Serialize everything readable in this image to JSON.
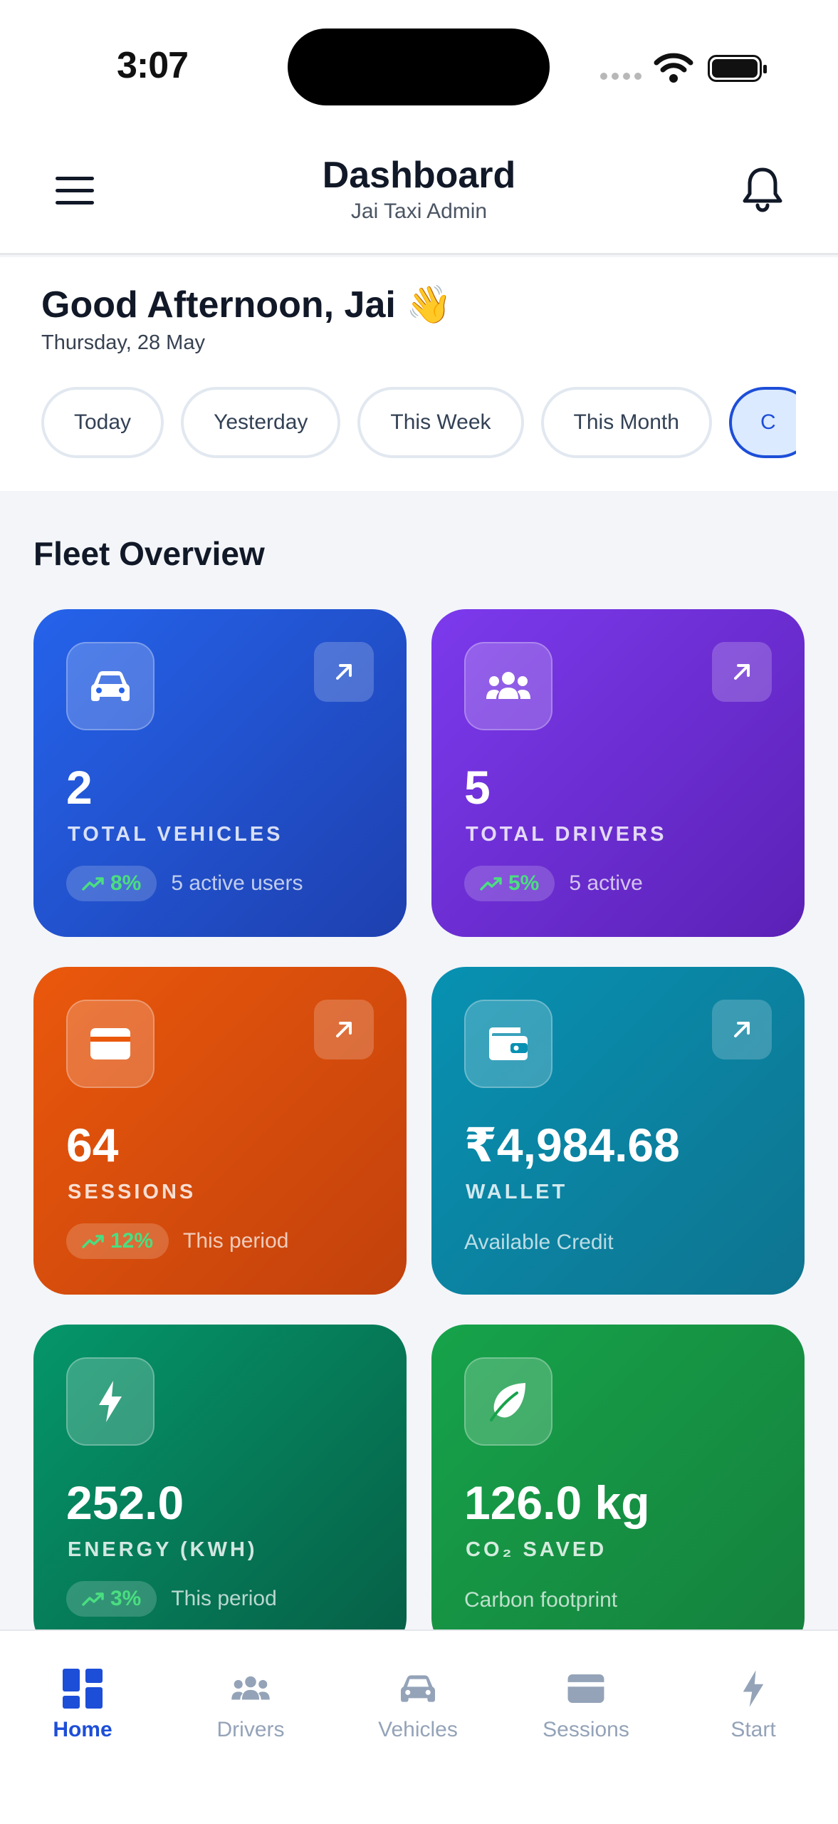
{
  "status_bar": {
    "time": "3:07"
  },
  "header": {
    "title": "Dashboard",
    "subtitle": "Jai Taxi Admin",
    "menu_icon": "hamburger-icon",
    "bell_icon": "bell-icon"
  },
  "greeting": {
    "title": "Good Afternoon, Jai 👋",
    "date": "Thursday, 28 May"
  },
  "filters": [
    "Today",
    "Yesterday",
    "This Week",
    "This Month",
    "C"
  ],
  "overview": {
    "title": "Fleet Overview",
    "cards": [
      {
        "value": "2",
        "label": "TOTAL VEHICLES",
        "trend": "8%",
        "note": "5 active users",
        "icon": "car-icon"
      },
      {
        "value": "5",
        "label": "TOTAL DRIVERS",
        "trend": "5%",
        "note": "5 active",
        "icon": "users-icon"
      },
      {
        "value": "64",
        "label": "SESSIONS",
        "trend": "12%",
        "note": "This period",
        "icon": "card-icon"
      },
      {
        "value": "₹4,984.68",
        "label": "WALLET",
        "note": "Available Credit",
        "icon": "wallet-icon"
      },
      {
        "value": "252.0",
        "label": "ENERGY (KWH)",
        "trend": "3%",
        "note": "This period",
        "icon": "bolt-icon"
      },
      {
        "value": "126.0 kg",
        "label": "CO₂ SAVED",
        "note": "Carbon footprint",
        "icon": "leaf-icon"
      }
    ]
  },
  "colors": {
    "accent": "#1d4ed8",
    "trend_green": "#4ade80"
  },
  "tabbar": {
    "tabs": [
      {
        "label": "Home",
        "icon": "grid-icon",
        "active": true
      },
      {
        "label": "Drivers",
        "icon": "users-icon",
        "active": false
      },
      {
        "label": "Vehicles",
        "icon": "car-icon",
        "active": false
      },
      {
        "label": "Sessions",
        "icon": "card-icon",
        "active": false
      },
      {
        "label": "Start",
        "icon": "bolt-icon",
        "active": false
      }
    ]
  }
}
